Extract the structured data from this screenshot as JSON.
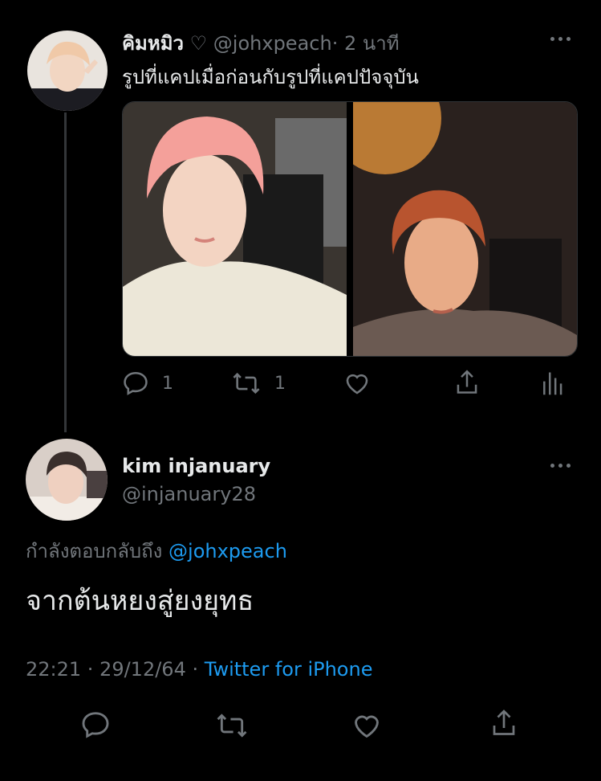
{
  "tweet": {
    "display_name": "คิมหมิว",
    "heart_symbol": "♡",
    "handle": "@johxpeach",
    "separator": "·",
    "time_ago": "2 นาที",
    "text": "รูปที่แคปเมื่อก่อนกับรูปที่แคปปัจจุบัน",
    "reply_count": "1",
    "retweet_count": "1"
  },
  "reply": {
    "display_name": "kim injanuary",
    "handle": "@injanuary28",
    "replying_to_label": "กำลังตอบกลับถึง",
    "replying_to_handle": "@johxpeach",
    "text": "จากต้นหยงสู่ยงยุทธ",
    "timestamp": "22:21 · 29/12/64 ·",
    "source": "Twitter for iPhone"
  },
  "icons": [
    "reply-icon",
    "retweet-icon",
    "like-icon",
    "share-icon",
    "analytics-icon",
    "more-icon"
  ],
  "colors": {
    "background": "#000000",
    "text": "#e7e9ea",
    "muted": "#71767b",
    "link": "#1d9bf0",
    "divider": "#333639"
  }
}
